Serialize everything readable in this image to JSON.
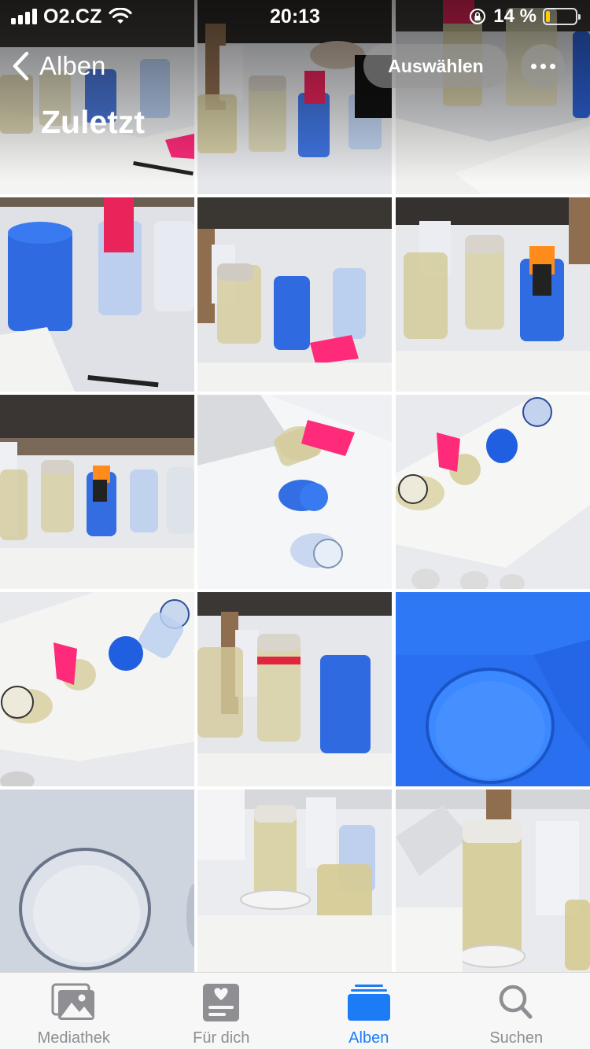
{
  "status_bar": {
    "carrier": "O2.CZ",
    "time": "20:13",
    "battery_percent_text": "14 %",
    "battery_level": 0.14,
    "signal_bars": 4
  },
  "nav": {
    "back_label": "Alben",
    "title": "Zuletzt",
    "select_label": "Auswählen"
  },
  "photos": [
    {
      "scene": "cups-side"
    },
    {
      "scene": "hand-blue-cup"
    },
    {
      "scene": "paper-wide"
    },
    {
      "scene": "blue-close"
    },
    {
      "scene": "row-blue-pink"
    },
    {
      "scene": "orange-flag"
    },
    {
      "scene": "row-orange"
    },
    {
      "scene": "top-pink-blue"
    },
    {
      "scene": "top-lying"
    },
    {
      "scene": "top-diagonal"
    },
    {
      "scene": "red-band"
    },
    {
      "scene": "blue-interior"
    },
    {
      "scene": "clear-interior"
    },
    {
      "scene": "clear-cups"
    },
    {
      "scene": "tall-capped"
    }
  ],
  "tab_bar": {
    "tabs": [
      {
        "label": "Mediathek",
        "icon": "photo-library-icon",
        "active": false
      },
      {
        "label": "Für dich",
        "icon": "for-you-icon",
        "active": false
      },
      {
        "label": "Alben",
        "icon": "albums-icon",
        "active": true
      },
      {
        "label": "Suchen",
        "icon": "search-icon",
        "active": false
      }
    ]
  },
  "colors": {
    "accent": "#1c7cf5",
    "inactive": "#8e8e93",
    "blue_cup": "#1f5fe0",
    "pink_paper": "#ff2a7a",
    "orange_paper": "#ff8c1a",
    "battery_fill": "#ffcc00"
  }
}
